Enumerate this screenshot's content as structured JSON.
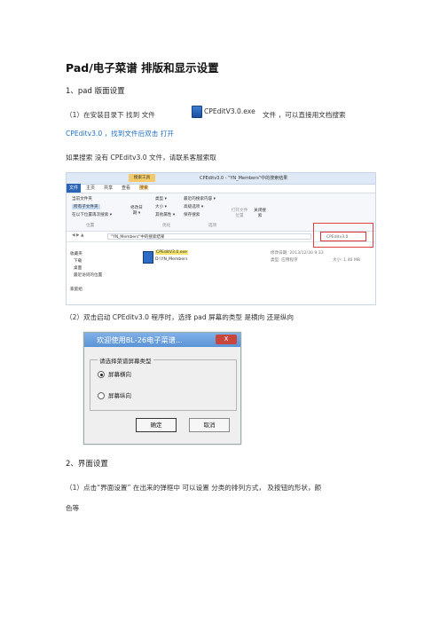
{
  "doc": {
    "title": "Pad/电子菜谱 排版和显示设置",
    "s1": "1、pad 版面设置",
    "p1a": "（1）在安装目录下  找到  文件",
    "exe_inline": "CPEditV3.0.exe",
    "p1b": "文件  ，可以直接用文档搜索",
    "p1c": "CPEditv3.0 ，找到文件后双击 打开",
    "p2": "如果搜索 没有 CPEditv3.0 文件，请联系客服索取",
    "p3": "（2）双击启动 CPEditv3.0 程序时，选择 pad 屏幕的类型  是横向  还是纵向",
    "s2": "2、界面设置",
    "p4a": "（1）点击“界面设置”  在出来的弹框中  可以设置  分类的排列方式，  及按钮的形状，颜",
    "p4b": "色等"
  },
  "explorer": {
    "window_title": "CPEditv3.0 - \"YN_Members\"中的搜索结果",
    "tool_tab": "搜索工具",
    "tabs": [
      "文件",
      "主页",
      "共享",
      "查看",
      "搜索"
    ],
    "ribbon": [
      "当前文件夹",
      "所有子文件夹",
      "在以下位置再次搜索 ▾",
      "修改日期 ▾",
      "类型 ▾",
      "大小 ▾",
      "其他属性 ▾",
      "最近的搜索内容 ▾",
      "高级选项 ▾",
      "保存搜索",
      "打开文件位置",
      "关闭搜索"
    ],
    "groups": [
      "位置",
      "优化",
      "选项"
    ],
    "address": "\"YN_Members\"中的搜索结果",
    "search": "CPEditv3.0",
    "nav": [
      "收藏夹",
      "下载",
      "桌面",
      "最近访问的位置",
      "家庭组"
    ],
    "file_name": "CPEditV3.0.exe",
    "file_path": "D:\\YN_Members",
    "mod_label": "修改日期: 2013/12/30 9:33",
    "type_label": "类型: 应用程序",
    "size_label": "大小: 1.46 MB"
  },
  "dialog": {
    "title": "欢迎使用BL-26电子菜谱...",
    "close": "X",
    "group": "请选择菜谱屏幕类型",
    "opt1": "屏幕横向",
    "opt2": "屏幕纵向",
    "ok": "确定",
    "cancel": "取消"
  },
  "colors": {
    "accent": "#1f6fc1",
    "highlight_red": "#e04040"
  }
}
